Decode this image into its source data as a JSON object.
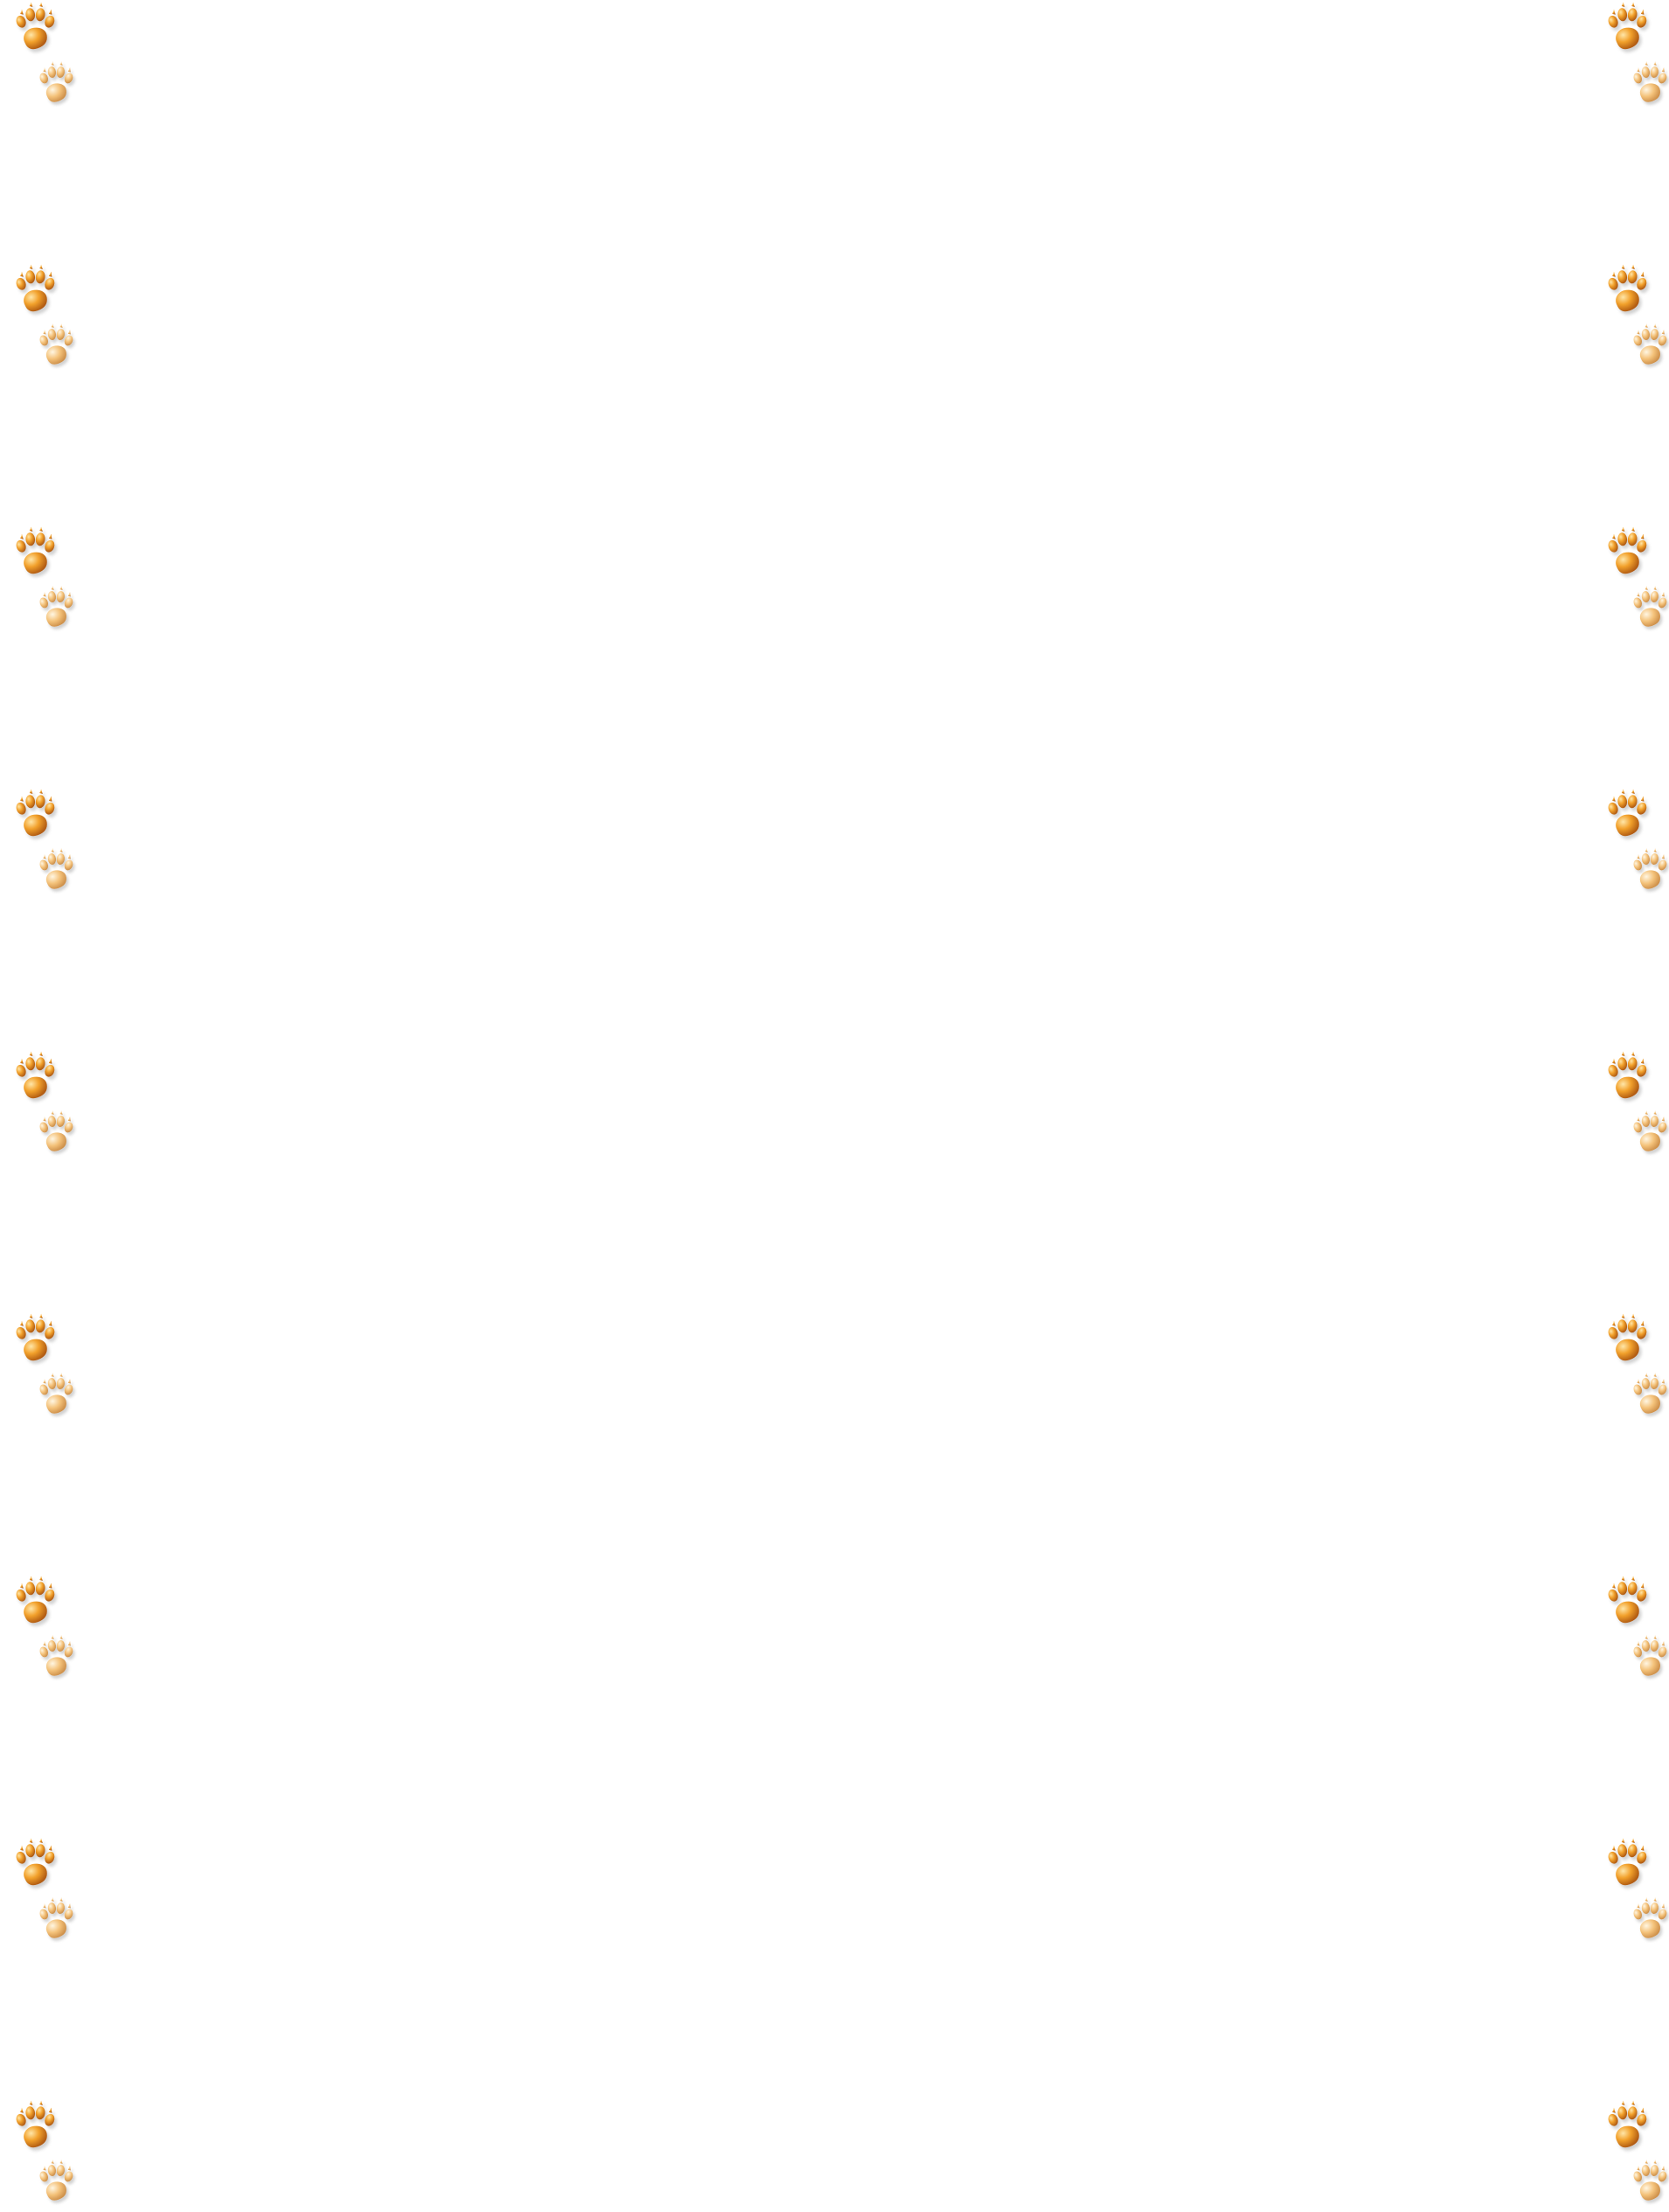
{
  "background_color": "#ffffff",
  "border": {
    "motif": "paw-print-icon",
    "rows": 9,
    "columns": [
      "left",
      "right"
    ],
    "paw_large_colors": {
      "highlight": "#ffd98a",
      "base": "#f2a12c",
      "shadow": "#a8520f"
    },
    "paw_small_colors": {
      "highlight": "#fff0d2",
      "base": "#f4c27a",
      "shadow": "#c98a45"
    }
  }
}
